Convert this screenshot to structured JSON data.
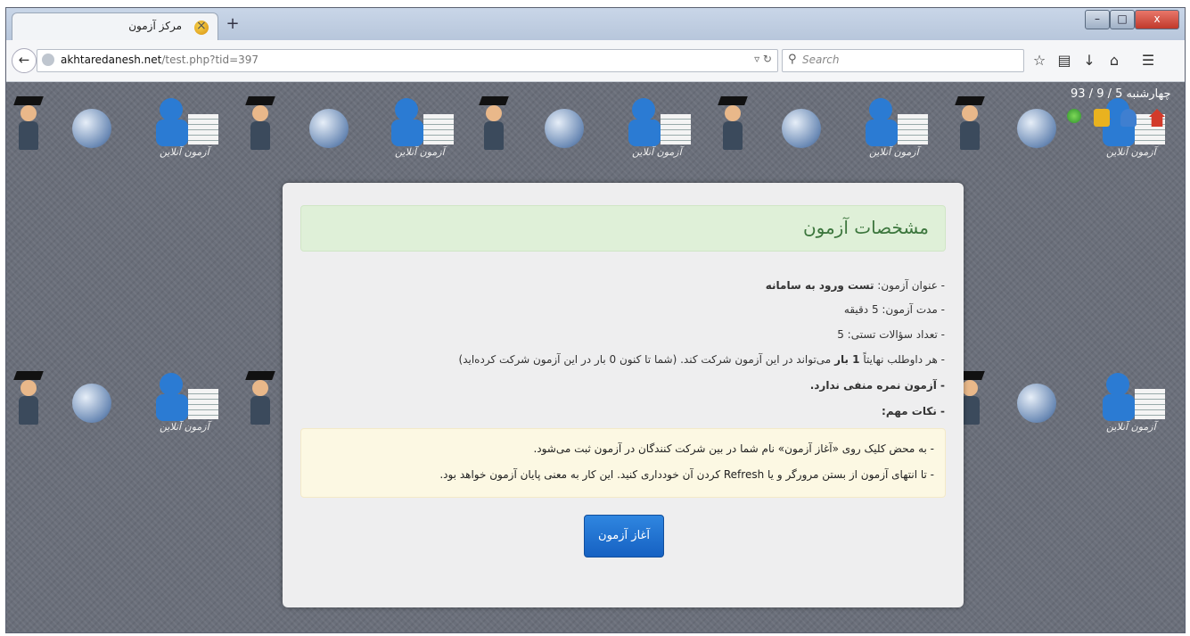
{
  "browser": {
    "tab_title": "مرکز آزمون",
    "tab_close": "×",
    "new_tab": "+",
    "url_host": "akhtaredanesh.net",
    "url_path": "/test.php?tid=397",
    "search_placeholder": "Search",
    "window_min": "–",
    "window_max": "□",
    "window_close": "x"
  },
  "header": {
    "date": "چهارشنبه 5 / 9 / 93",
    "deco_label": "آزمون آنلاین"
  },
  "exam": {
    "heading": "مشخصات آزمون",
    "title_label": "- عنوان آزمون: ",
    "title_value": "تست ورود به سامانه",
    "duration": "- مدت آزمون: 5 دقیقه",
    "question_count": "- تعداد سؤالات تستی: 5",
    "attempts_prefix": "- هر داوطلب نهایتاً ",
    "attempts_bold": "1 بار",
    "attempts_suffix": " می‌تواند در این آزمون شرکت کند. (شما تا کنون 0 بار در این آزمون شرکت کرده‌اید)",
    "negative_marking": "- آزمون نمره منفی ندارد.",
    "notes_heading": "- نکات مهم:"
  },
  "notes": {
    "note1": "- به محض کلیک روی «آغاز آزمون» نام شما در بین شرکت کنندگان در آزمون ثبت می‌شود.",
    "note2": "- تا انتهای آزمون از بستن مرورگر و یا Refresh کردن آن خودداری کنید. این کار به معنی پایان آزمون خواهد بود."
  },
  "start_button": "آغاز آزمون",
  "colors": {
    "success_bg": "#dff0d8",
    "success_text": "#3c763d",
    "warning_bg": "#fcf8e3",
    "button_primary": "#1e6fd2"
  }
}
